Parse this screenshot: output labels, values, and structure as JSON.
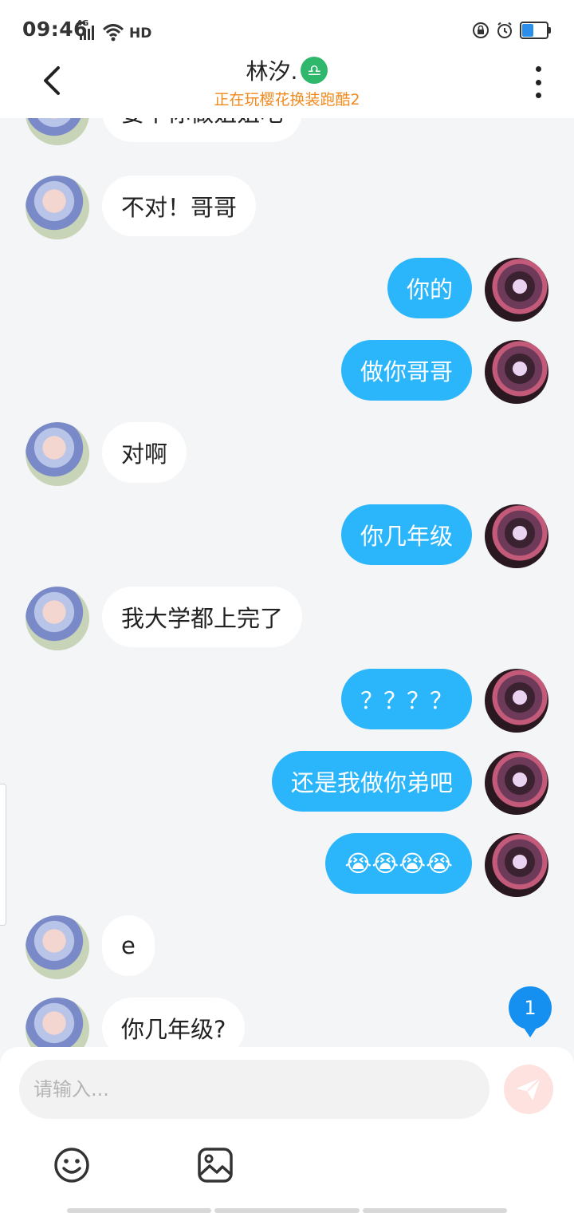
{
  "status_bar": {
    "time": "09:46",
    "network": "4G",
    "hd": "HD",
    "icons": [
      "signal-icon",
      "wifi-icon",
      "hd-icon",
      "lock-rotation-icon",
      "alarm-icon",
      "battery-icon"
    ],
    "battery_level": 0.45
  },
  "header": {
    "title": "林汐.",
    "zodiac_symbol": "♎",
    "subtitle": "正在玩樱花换装跑酷2",
    "back_icon": "chevron-left-icon",
    "more_icon": "more-vertical-icon"
  },
  "messages": [
    {
      "side": "in",
      "text": "要不你做姐姐吧"
    },
    {
      "side": "in",
      "text": "不对！哥哥"
    },
    {
      "side": "out",
      "text": "你的"
    },
    {
      "side": "out",
      "text": "做你哥哥"
    },
    {
      "side": "in",
      "text": "对啊"
    },
    {
      "side": "out",
      "text": "你几年级"
    },
    {
      "side": "in",
      "text": "我大学都上完了"
    },
    {
      "side": "out",
      "text": "？？？？"
    },
    {
      "side": "out",
      "text": "还是我做你弟吧"
    },
    {
      "side": "out",
      "text": "😭😭😭😭"
    },
    {
      "side": "in",
      "text": "e"
    },
    {
      "side": "in",
      "text": "你几年级?"
    }
  ],
  "unread_badge": "1",
  "composer": {
    "placeholder": "请输入...",
    "send_icon": "send-icon",
    "emoji_icon": "emoji-icon",
    "image_icon": "image-icon"
  },
  "colors": {
    "accent_blue": "#2bb6fb",
    "badge_blue": "#1690f0",
    "subtitle_orange": "#f08a1e",
    "zodiac_green": "#2fb76b",
    "background": "#f4f5f7"
  }
}
